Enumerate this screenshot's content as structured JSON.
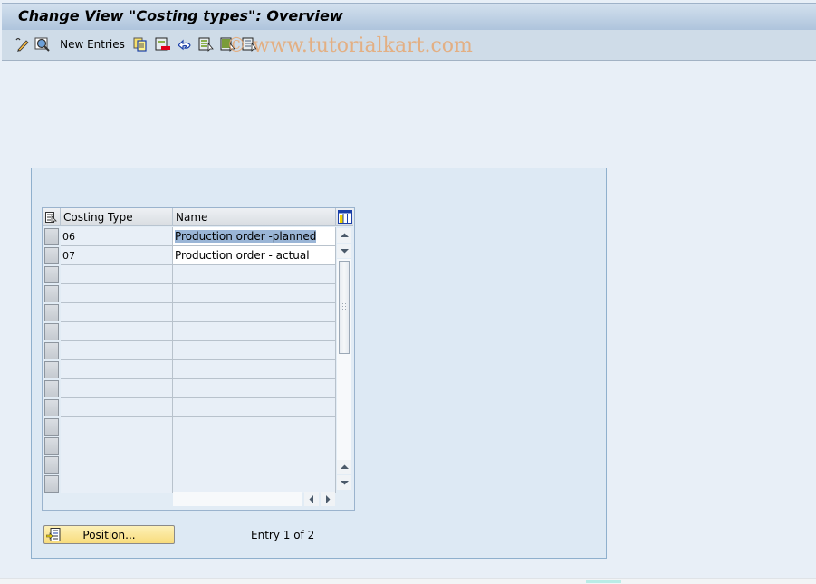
{
  "window": {
    "title": "Change View \"Costing types\": Overview"
  },
  "toolbar": {
    "items": [
      {
        "icon": "display-change-icon",
        "tooltip": "Display -> Change"
      },
      {
        "icon": "find-icon",
        "tooltip": "Find"
      },
      {
        "label": "New Entries"
      },
      {
        "icon": "copy-as-icon"
      },
      {
        "icon": "delete-icon"
      },
      {
        "icon": "undo-change-icon"
      },
      {
        "icon": "select-all-icon"
      },
      {
        "icon": "select-block-icon"
      },
      {
        "icon": "deselect-all-icon"
      }
    ],
    "new_entries_label": "New Entries"
  },
  "watermark": "© www.tutorialkart.com",
  "table": {
    "columns": [
      "Costing Type",
      "Name"
    ],
    "rows": [
      {
        "costing_type": "06",
        "name": "Production order -planned",
        "selected": true
      },
      {
        "costing_type": "07",
        "name": "Production order - actual",
        "selected": false
      }
    ],
    "visible_row_count": 14
  },
  "footer": {
    "position_button": "Position...",
    "entry_info": "Entry 1 of 2"
  },
  "colors": {
    "title_bar": "#aec4dc",
    "toolbar": "#cfdce8",
    "background": "#e8eff7",
    "panel": "#dde9f4",
    "position_button": "#f8dc7c",
    "selection": "#9ab5d6",
    "watermark": "#e8a46a"
  }
}
